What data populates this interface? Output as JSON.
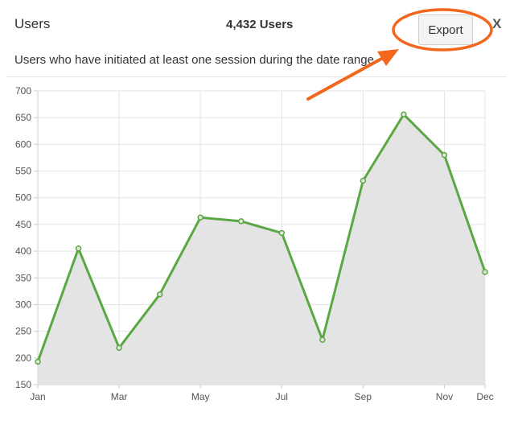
{
  "panel": {
    "title": "Users",
    "user_count": "4,432 Users",
    "export_label": "Export",
    "close_label": "X",
    "subtitle": "Users who have initiated at least one session during the date range"
  },
  "colors": {
    "line": "#5aa843",
    "area": "#e3e3e3",
    "grid": "#e4e4e4",
    "annotation": "#f2661e"
  },
  "chart_data": {
    "type": "area",
    "x": [
      "Jan",
      "Feb",
      "Mar",
      "Apr",
      "May",
      "Jun",
      "Jul",
      "Aug",
      "Sep",
      "Oct",
      "Nov",
      "Dec"
    ],
    "x_tick_labels": [
      "Jan",
      "Mar",
      "May",
      "Jul",
      "Sep",
      "Nov",
      "Dec"
    ],
    "series": [
      {
        "values": [
          193,
          405,
          219,
          319,
          463,
          456,
          434,
          234,
          532,
          656,
          580,
          361
        ]
      }
    ],
    "ylim": [
      150,
      700
    ],
    "y_ticks": [
      150,
      200,
      250,
      300,
      350,
      400,
      450,
      500,
      550,
      600,
      650,
      700
    ],
    "grid": true,
    "title": "",
    "xlabel": "",
    "ylabel": ""
  }
}
